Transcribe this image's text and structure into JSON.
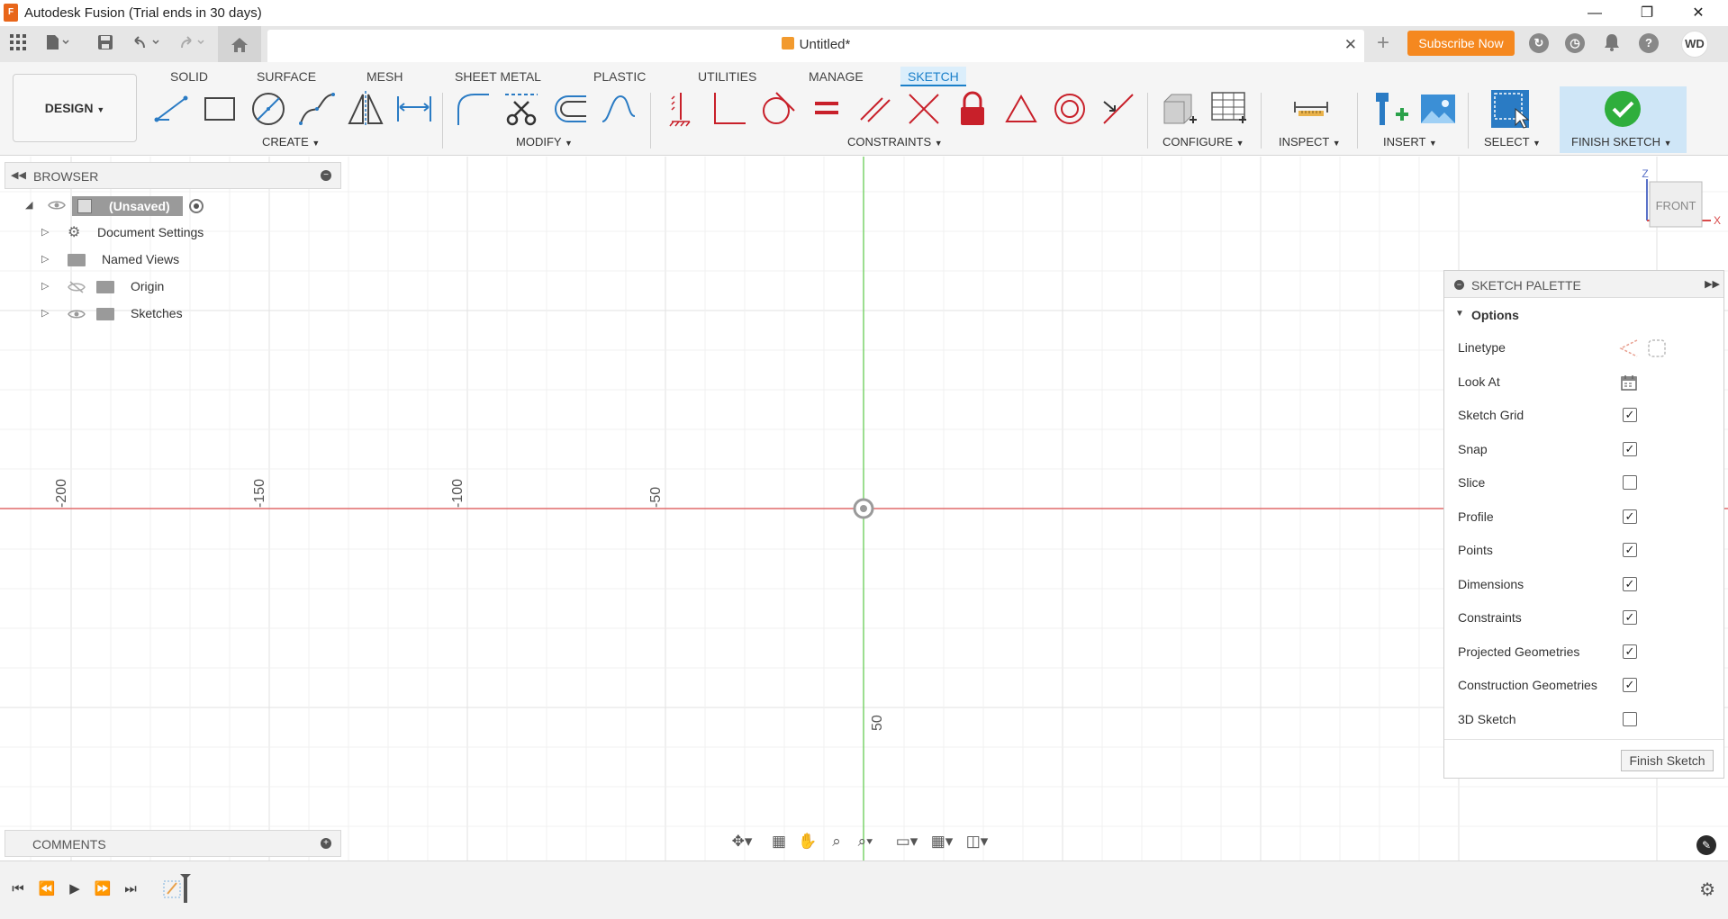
{
  "window": {
    "title": "Autodesk Fusion (Trial ends in 30 days)",
    "logo_text": "F",
    "minimize": "—",
    "restore": "❐",
    "close": "✕"
  },
  "toolbar": {
    "doc_name": "Untitled*",
    "subscribe_label": "Subscribe Now",
    "user_initials": "WD",
    "icons": [
      "apps-grid-icon",
      "file-icon",
      "save-icon",
      "undo-icon",
      "redo-icon",
      "home-icon"
    ],
    "right_icons": [
      "add-tab-icon",
      "extensions-icon",
      "job-status-icon",
      "notifications-icon",
      "help-icon"
    ]
  },
  "ribbon": {
    "workspace": "DESIGN",
    "tabs": [
      "SOLID",
      "SURFACE",
      "MESH",
      "SHEET METAL",
      "PLASTIC",
      "UTILITIES",
      "MANAGE",
      "SKETCH"
    ],
    "active_tab": "SKETCH",
    "groups": {
      "create": "CREATE",
      "modify": "MODIFY",
      "constraints": "CONSTRAINTS",
      "configure": "CONFIGURE",
      "inspect": "INSPECT",
      "insert": "INSERT",
      "select": "SELECT",
      "finish": "FINISH SKETCH"
    },
    "accent_color": "#1a7fc9",
    "constraint_color": "#c8202a"
  },
  "browser": {
    "title": "BROWSER",
    "root": "(Unsaved)",
    "items": [
      "Document Settings",
      "Named Views",
      "Origin",
      "Sketches"
    ]
  },
  "canvas": {
    "axis_labels_x": [
      "-200",
      "-150",
      "-100",
      "-50"
    ],
    "axis_labels_y": [
      "50"
    ],
    "viewcube": {
      "face": "FRONT",
      "axis_z": "Z",
      "axis_x": "X"
    }
  },
  "palette": {
    "title": "SKETCH PALETTE",
    "section": "Options",
    "rows": [
      {
        "label": "Linetype",
        "kind": "icons"
      },
      {
        "label": "Look At",
        "kind": "icon"
      },
      {
        "label": "Sketch Grid",
        "kind": "check",
        "checked": true
      },
      {
        "label": "Snap",
        "kind": "check",
        "checked": true
      },
      {
        "label": "Slice",
        "kind": "check",
        "checked": false
      },
      {
        "label": "Profile",
        "kind": "check",
        "checked": true
      },
      {
        "label": "Points",
        "kind": "check",
        "checked": true
      },
      {
        "label": "Dimensions",
        "kind": "check",
        "checked": true
      },
      {
        "label": "Constraints",
        "kind": "check",
        "checked": true
      },
      {
        "label": "Projected Geometries",
        "kind": "check",
        "checked": true
      },
      {
        "label": "Construction Geometries",
        "kind": "check",
        "checked": true
      },
      {
        "label": "3D Sketch",
        "kind": "check",
        "checked": false
      }
    ],
    "finish_label": "Finish Sketch"
  },
  "comments": {
    "title": "COMMENTS"
  },
  "timeline": {
    "buttons": [
      "first",
      "previous",
      "play",
      "next",
      "last"
    ]
  }
}
